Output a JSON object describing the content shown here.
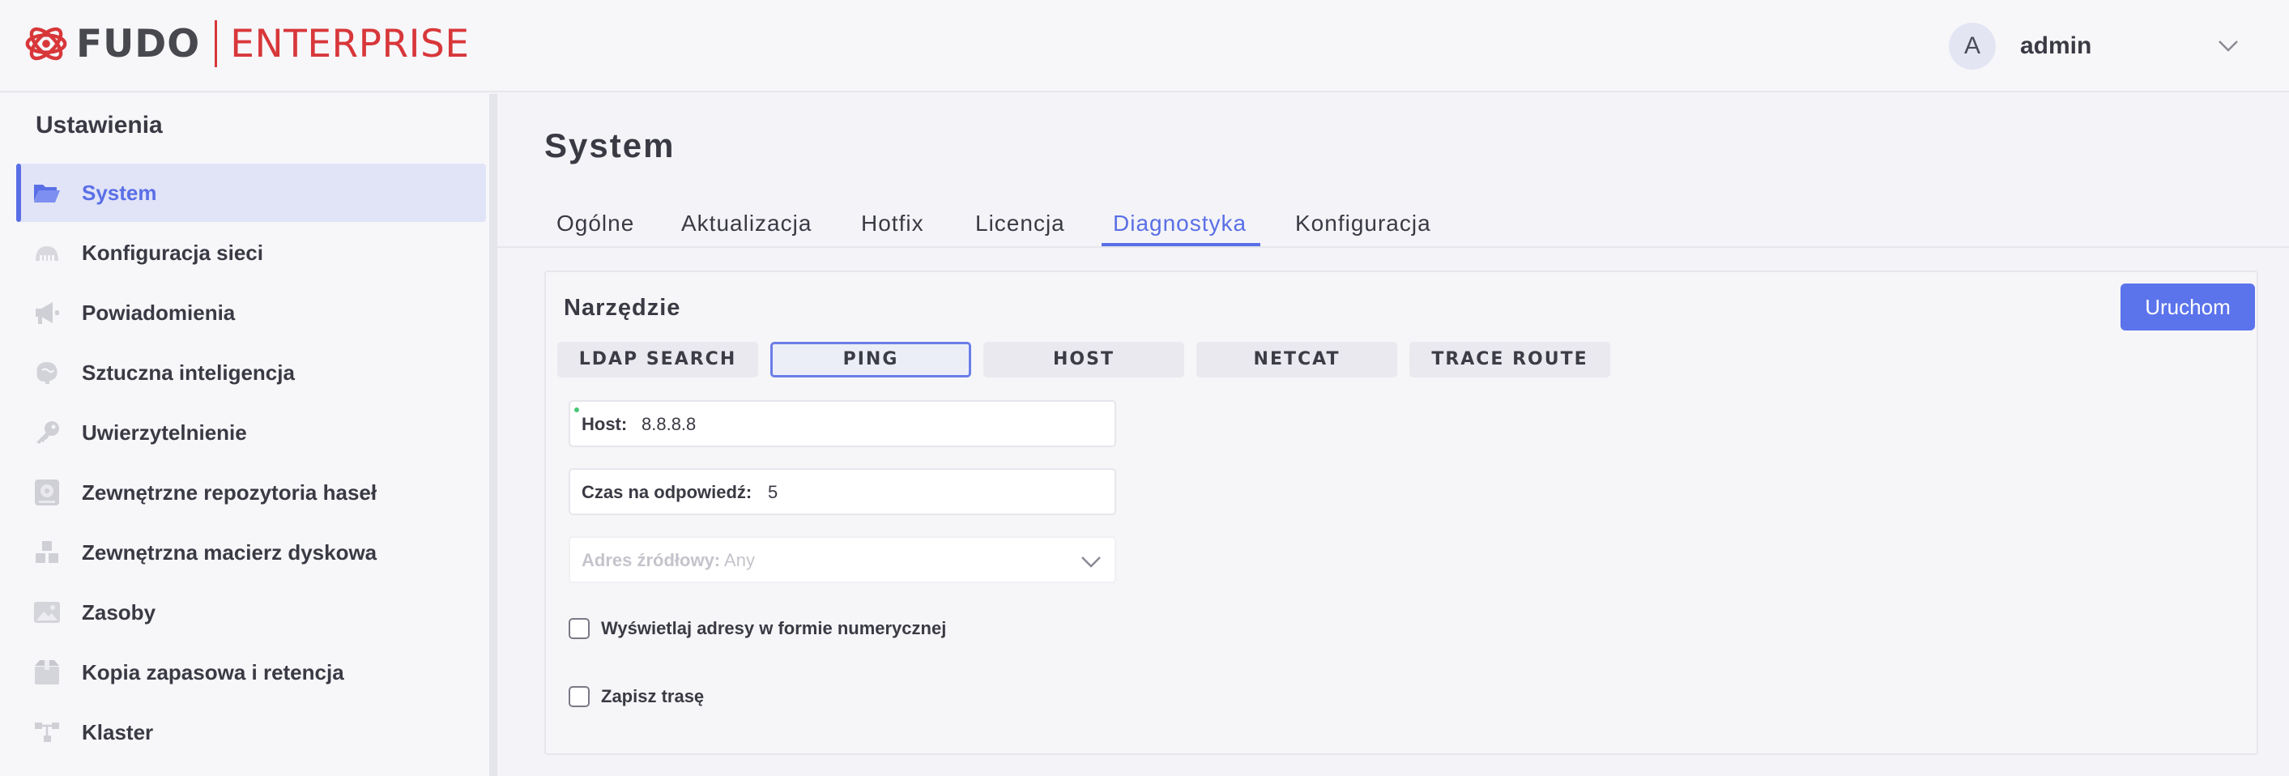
{
  "header": {
    "logo_fudo": "FUDO",
    "logo_enterprise": "ENTERPRISE",
    "avatar_initial": "A",
    "username": "admin"
  },
  "colors": {
    "accent": "#5a6fe6",
    "brand_red": "#d8373a",
    "primary_button": "#5b73eb"
  },
  "sidebar": {
    "title": "Ustawienia",
    "items": [
      {
        "label": "System",
        "icon": "folder-open-icon",
        "active": true
      },
      {
        "label": "Konfiguracja sieci",
        "icon": "network-icon"
      },
      {
        "label": "Powiadomienia",
        "icon": "megaphone-icon"
      },
      {
        "label": "Sztuczna inteligencja",
        "icon": "brain-icon"
      },
      {
        "label": "Uwierzytelnienie",
        "icon": "key-icon"
      },
      {
        "label": "Zewnętrzne repozytoria haseł",
        "icon": "vault-icon"
      },
      {
        "label": "Zewnętrzna macierz dyskowa",
        "icon": "disk-array-icon"
      },
      {
        "label": "Zasoby",
        "icon": "image-icon"
      },
      {
        "label": "Kopia zapasowa i retencja",
        "icon": "backup-box-icon"
      },
      {
        "label": "Klaster",
        "icon": "cluster-icon"
      }
    ]
  },
  "main": {
    "title": "System",
    "tabs": [
      {
        "label": "Ogólne"
      },
      {
        "label": "Aktualizacja"
      },
      {
        "label": "Hotfix"
      },
      {
        "label": "Licencja"
      },
      {
        "label": "Diagnostyka",
        "active": true
      },
      {
        "label": "Konfiguracja"
      }
    ],
    "tool_panel": {
      "title": "Narzędzie",
      "run_label": "Uruchom",
      "tools": [
        "LDAP SEARCH",
        "PING",
        "HOST",
        "NETCAT",
        "TRACE ROUTE"
      ],
      "selected_tool": "PING",
      "host": {
        "label": "Host:",
        "value": "8.8.8.8"
      },
      "timeout": {
        "label": "Czas na odpowiedź:",
        "value": "5"
      },
      "source_address": {
        "label": "Adres źródłowy:",
        "value": "Any"
      },
      "numeric_checkbox": {
        "label": "Wyświetlaj adresy w formie numerycznej",
        "checked": false
      },
      "record_route_checkbox": {
        "label": "Zapisz trasę",
        "checked": false
      }
    }
  }
}
